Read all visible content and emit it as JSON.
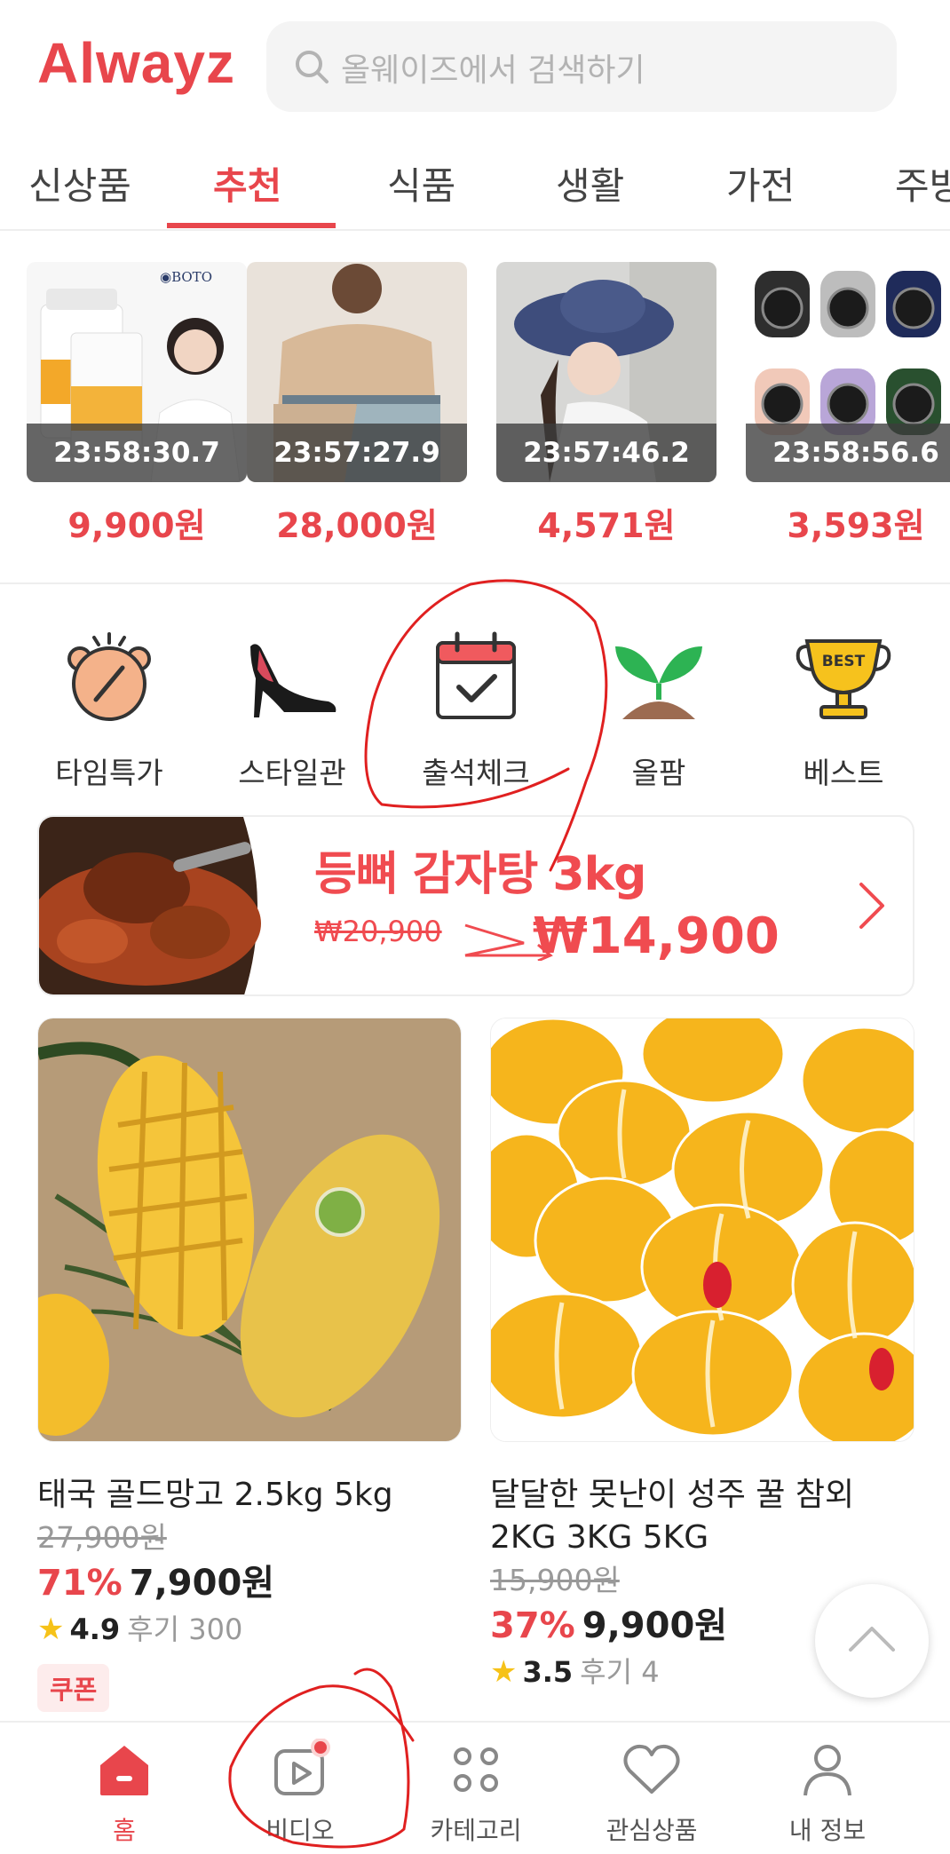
{
  "header": {
    "logo": "Alwayz",
    "search_placeholder": "올웨이즈에서 검색하기"
  },
  "tabs": [
    {
      "label": "신상품"
    },
    {
      "label": "추천"
    },
    {
      "label": "식품"
    },
    {
      "label": "생활"
    },
    {
      "label": "가전"
    },
    {
      "label": "주방"
    }
  ],
  "timed_deals": [
    {
      "timer": "23:58:30.7",
      "price": "9,900원",
      "brand": "BOTO"
    },
    {
      "timer": "23:57:27.9",
      "price": "28,000원"
    },
    {
      "timer": "23:57:46.2",
      "price": "4,571원"
    },
    {
      "timer": "23:58:56.6",
      "price": "3,593원"
    }
  ],
  "quick_menu": [
    {
      "label": "타임특가",
      "icon": "alarm-clock-icon"
    },
    {
      "label": "스타일관",
      "icon": "high-heel-icon"
    },
    {
      "label": "출석체크",
      "icon": "calendar-check-icon"
    },
    {
      "label": "올팜",
      "icon": "sprout-icon"
    },
    {
      "label": "베스트",
      "icon": "best-trophy-icon",
      "badge": "BEST"
    }
  ],
  "banner": {
    "title": "등뼈 감자탕 3kg",
    "old_price": "₩20,900",
    "new_price": "₩14,900"
  },
  "products": [
    {
      "name": "태국 골드망고 2.5kg 5kg",
      "original_price": "27,900원",
      "discount": "71%",
      "price": "7,900원",
      "rating": "4.9",
      "reviews": "후기 300",
      "coupon": "쿠폰"
    },
    {
      "name": "달달한 못난이 성주 꿀 참외 2KG 3KG 5KG",
      "original_price": "15,900원",
      "discount": "37%",
      "price": "9,900원",
      "rating": "3.5",
      "reviews": "후기 4"
    }
  ],
  "bottom_nav": [
    {
      "label": "홈",
      "icon": "home-icon",
      "active": true
    },
    {
      "label": "비디오",
      "icon": "video-icon"
    },
    {
      "label": "카테고리",
      "icon": "category-icon"
    },
    {
      "label": "관심상품",
      "icon": "heart-icon"
    },
    {
      "label": "내 정보",
      "icon": "user-icon"
    }
  ],
  "colors": {
    "accent": "#e8464c",
    "star": "#f6c218",
    "annotation": "#e02020"
  }
}
